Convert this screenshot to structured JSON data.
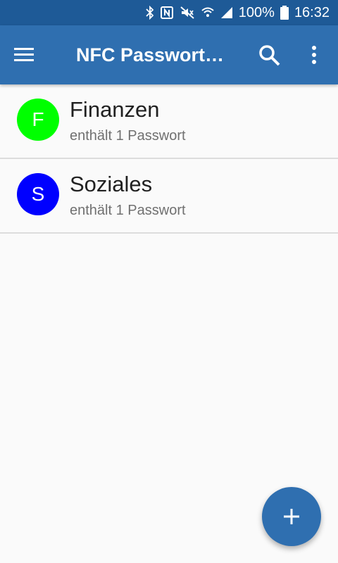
{
  "status_bar": {
    "battery": "100%",
    "time": "16:32",
    "icons": [
      "bluetooth-icon",
      "nfc-icon",
      "mute-icon",
      "wifi-icon",
      "signal-icon",
      "battery-icon"
    ]
  },
  "app_bar": {
    "title": "NFC Passwort…",
    "icons": [
      "menu-icon",
      "search-icon",
      "more-vert-icon"
    ]
  },
  "list": {
    "items": [
      {
        "initial": "F",
        "title": "Finanzen",
        "subtitle": "enthält 1 Passwort",
        "color": "#00ff00"
      },
      {
        "initial": "S",
        "title": "Soziales",
        "subtitle": "enthält 1 Passwort",
        "color": "#0000ff"
      }
    ]
  },
  "fab": {
    "icon": "plus-icon"
  },
  "colors": {
    "status_bar": "#1e5a97",
    "app_bar": "#2f6fb0",
    "background": "#fafafa"
  }
}
